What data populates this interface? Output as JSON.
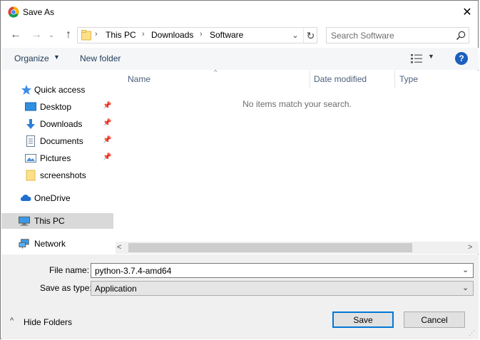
{
  "window": {
    "title": "Save As",
    "close_glyph": "✕"
  },
  "nav": {
    "back_glyph": "←",
    "forward_glyph": "→",
    "recent_glyph": "⌄",
    "up_glyph": "↑"
  },
  "address": {
    "crumbs": [
      "This PC",
      "Downloads",
      "Software"
    ],
    "separator": "›",
    "dropdown_glyph": "⌄",
    "refresh_glyph": "↻"
  },
  "search": {
    "placeholder": "Search Software"
  },
  "toolbar": {
    "organize_label": "Organize",
    "organize_arrow": "▼",
    "new_folder_label": "New folder",
    "view_arrow": "▼",
    "help_label": "?"
  },
  "sidebar": {
    "items": [
      {
        "label": "Quick access",
        "icon": "star-icon",
        "pinned": false
      },
      {
        "label": "Desktop",
        "icon": "desktop-icon",
        "pinned": true
      },
      {
        "label": "Downloads",
        "icon": "download-icon",
        "pinned": true
      },
      {
        "label": "Documents",
        "icon": "documents-icon",
        "pinned": true
      },
      {
        "label": "Pictures",
        "icon": "pictures-icon",
        "pinned": true
      },
      {
        "label": "screenshots",
        "icon": "folder-icon",
        "pinned": false
      },
      {
        "label": "OneDrive",
        "icon": "cloud-icon",
        "pinned": false
      },
      {
        "label": "This PC",
        "icon": "computer-icon",
        "pinned": false,
        "selected": true
      },
      {
        "label": "Network",
        "icon": "network-icon",
        "pinned": false
      }
    ],
    "pin_glyph": "📌"
  },
  "filelist": {
    "columns": [
      "Name",
      "Date modified",
      "Type"
    ],
    "sort_glyph": "^",
    "empty_message": "No items match your search."
  },
  "scrollbar": {
    "left_glyph": "<",
    "right_glyph": ">"
  },
  "form": {
    "filename_label": "File name:",
    "filename_value": "python-3.7.4-amd64",
    "savetype_label": "Save as type:",
    "savetype_value": "Application",
    "dropdown_glyph": "⌄"
  },
  "footer": {
    "hide_folders_arrow": "^",
    "hide_folders_label": "Hide Folders",
    "save_label": "Save",
    "cancel_label": "Cancel"
  },
  "colors": {
    "accent": "#0078d7",
    "toolbar_text": "#1e395b",
    "selection": "#d9d9d9",
    "help": "#1c5fbf"
  }
}
